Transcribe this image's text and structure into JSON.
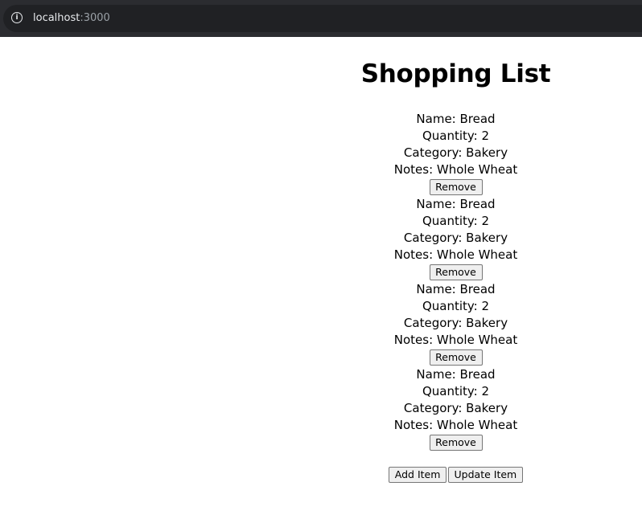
{
  "browser": {
    "url_host": "localhost",
    "url_port": ":3000",
    "icon": "info-icon"
  },
  "page": {
    "title": "Shopping List",
    "items": [
      {
        "name": "Name: Bread",
        "quantity": "Quantity: 2",
        "category": "Category: Bakery",
        "notes": "Notes: Whole Wheat",
        "remove_label": "Remove"
      },
      {
        "name": "Name: Bread",
        "quantity": "Quantity: 2",
        "category": "Category: Bakery",
        "notes": "Notes: Whole Wheat",
        "remove_label": "Remove"
      },
      {
        "name": "Name: Bread",
        "quantity": "Quantity: 2",
        "category": "Category: Bakery",
        "notes": "Notes: Whole Wheat",
        "remove_label": "Remove"
      },
      {
        "name": "Name: Bread",
        "quantity": "Quantity: 2",
        "category": "Category: Bakery",
        "notes": "Notes: Whole Wheat",
        "remove_label": "Remove"
      }
    ],
    "add_label": "Add Item",
    "update_label": "Update Item"
  }
}
